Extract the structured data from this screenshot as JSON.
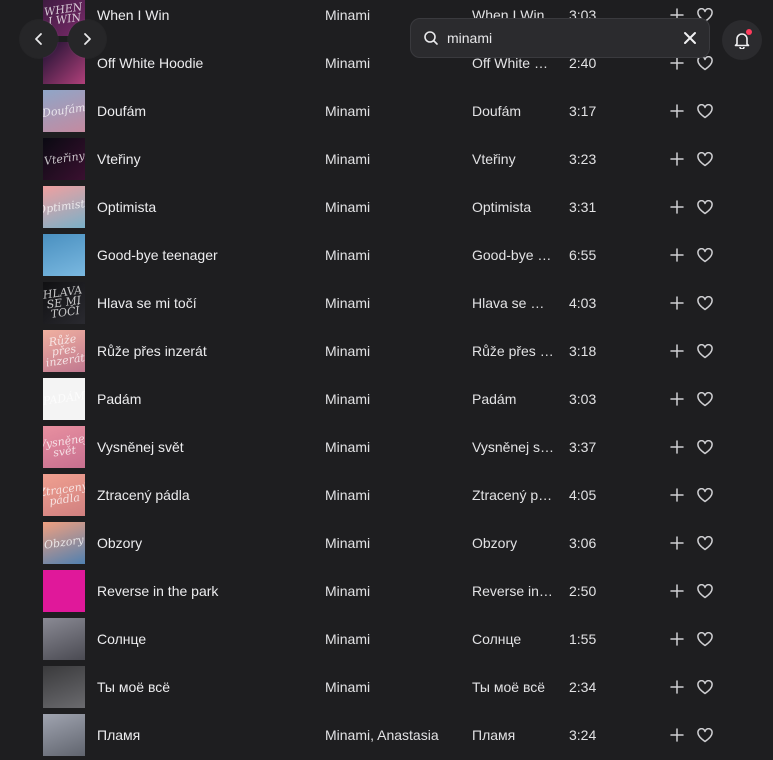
{
  "header": {
    "back_label": "",
    "forward_label": "",
    "search": {
      "value": "minami",
      "placeholder": ""
    },
    "notifications_unread": true
  },
  "colors": {
    "background": "#1e1e20",
    "accent": "#ff3b5c"
  },
  "tracks": [
    {
      "title": "When I Win",
      "artist": "Minami",
      "album": "When I Win",
      "duration": "3:03",
      "cover": {
        "bg": "linear-gradient(135deg,#3a1a3e,#7a2a6a)",
        "text": "WHEN I WIN"
      }
    },
    {
      "title": "Off White Hoodie",
      "artist": "Minami",
      "album": "Off White Hoodie",
      "duration": "2:40",
      "cover": {
        "bg": "linear-gradient(135deg,#1a1030,#b0407a)",
        "text": ""
      }
    },
    {
      "title": "Doufám",
      "artist": "Minami",
      "album": "Doufám",
      "duration": "3:17",
      "cover": {
        "bg": "linear-gradient(160deg,#8fa6c8,#c48aa0)",
        "text": "Doufám"
      }
    },
    {
      "title": "Vteřiny",
      "artist": "Minami",
      "album": "Vteřiny",
      "duration": "3:23",
      "cover": {
        "bg": "linear-gradient(135deg,#0a0a12,#3a1030)",
        "text": "Vteřiny"
      }
    },
    {
      "title": "Optimista",
      "artist": "Minami",
      "album": "Optimista",
      "duration": "3:31",
      "cover": {
        "bg": "linear-gradient(160deg,#f0a0a0,#7ab0c8)",
        "text": "Optimista"
      }
    },
    {
      "title": "Good-bye teenager",
      "artist": "Minami",
      "album": "Good-bye teenager",
      "duration": "6:55",
      "cover": {
        "bg": "linear-gradient(160deg,#4a90c0,#7ab8e0)",
        "text": ""
      }
    },
    {
      "title": "Hlava se mi točí",
      "artist": "Minami",
      "album": "Hlava se mi točí",
      "duration": "4:03",
      "cover": {
        "bg": "linear-gradient(135deg,#101012,#2a2a30)",
        "text": "HLAVA SE MI TOČÍ"
      }
    },
    {
      "title": "Růže přes inzerát",
      "artist": "Minami",
      "album": "Růže přes inzerát",
      "duration": "3:18",
      "cover": {
        "bg": "linear-gradient(160deg,#f0b0a0,#c07890)",
        "text": "Růže přes inzerát"
      }
    },
    {
      "title": "Padám",
      "artist": "Minami",
      "album": "Padám",
      "duration": "3:03",
      "cover": {
        "bg": "#f4f4f4",
        "text": "PADÁM"
      }
    },
    {
      "title": "Vysněnej svět",
      "artist": "Minami",
      "album": "Vysněnej svět",
      "duration": "3:37",
      "cover": {
        "bg": "linear-gradient(160deg,#e890a0,#c87090)",
        "text": "Vysněnej svět"
      }
    },
    {
      "title": "Ztracený pádla",
      "artist": "Minami",
      "album": "Ztracený pádla",
      "duration": "4:05",
      "cover": {
        "bg": "linear-gradient(160deg,#f0a090,#d08080)",
        "text": "Ztracený pádla"
      }
    },
    {
      "title": "Obzory",
      "artist": "Minami",
      "album": "Obzory",
      "duration": "3:06",
      "cover": {
        "bg": "linear-gradient(160deg,#f0a080,#5080b0)",
        "text": "Obzory"
      }
    },
    {
      "title": "Reverse in the park",
      "artist": "Minami",
      "album": "Reverse in the park",
      "duration": "2:50",
      "cover": {
        "bg": "#e0189a",
        "text": ""
      }
    },
    {
      "title": "Солнце",
      "artist": "Minami",
      "album": "Солнце",
      "duration": "1:55",
      "cover": {
        "bg": "linear-gradient(160deg,#8a8a94,#4a4a52)",
        "text": ""
      }
    },
    {
      "title": "Ты моё всё",
      "artist": "Minami",
      "album": "Ты моё всё",
      "duration": "2:34",
      "cover": {
        "bg": "linear-gradient(160deg,#3a3a3c,#6a6a6e)",
        "text": ""
      }
    },
    {
      "title": "Пламя",
      "artist": "Minami, Anastasia",
      "album": "Пламя",
      "duration": "3:24",
      "cover": {
        "bg": "linear-gradient(160deg,#a0a4b0,#60646e)",
        "text": ""
      }
    }
  ]
}
